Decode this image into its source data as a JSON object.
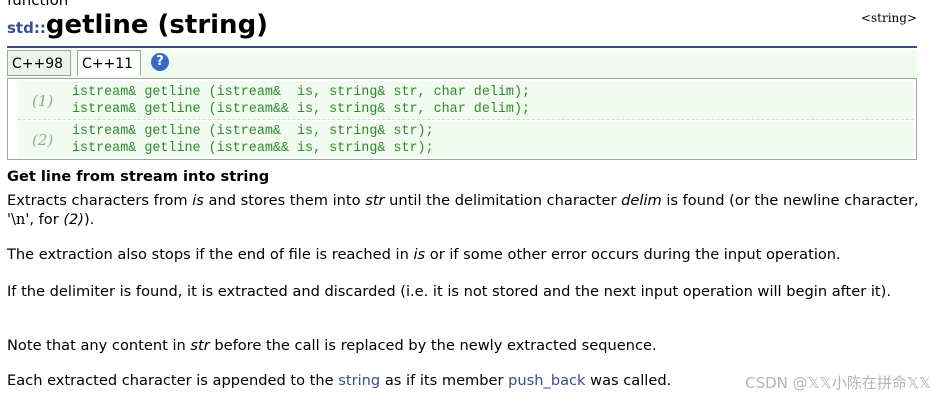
{
  "header": {
    "category": "function",
    "namespace": "std::",
    "function_name": "getline (string)",
    "header_tag": "<string>"
  },
  "tabs": {
    "cpp98": "C++98",
    "cpp11": "C++11",
    "help": "?"
  },
  "signatures": [
    {
      "number": "(1)",
      "lines": [
        "istream& getline (istream&  is, string& str, char delim);",
        "istream& getline (istream&& is, string& str, char delim);"
      ]
    },
    {
      "number": "(2)",
      "lines": [
        "istream& getline (istream&  is, string& str);",
        "istream& getline (istream&& is, string& str);"
      ]
    }
  ],
  "summary": "Get line from stream into string",
  "paragraphs": {
    "p1": {
      "t1": "Extracts characters from ",
      "i1": "is",
      "t2": " and stores them into ",
      "i2": "str",
      "t3": " until the delimitation character ",
      "i3": "delim",
      "t4": " is found (or the newline character, ",
      "code": "'\\n'",
      "t5": ", for ",
      "i4": "(2)",
      "t6": ")."
    },
    "p2": {
      "t1": "The extraction also stops if the end of file is reached in ",
      "i1": "is",
      "t2": " or if some other error occurs during the input operation."
    },
    "p3": "If the delimiter is found, it is extracted and discarded (i.e. it is not stored and the next input operation will begin after it).",
    "p4": {
      "t1": "Note that any content in ",
      "i1": "str",
      "t2": " before the call is replaced by the newly extracted sequence."
    },
    "p5": {
      "t1": "Each extracted character is appended to the ",
      "link1": "string",
      "t2": " as if its member ",
      "link2": "push_back",
      "t3": " was called."
    }
  },
  "watermark": "CSDN @𝕏𝕏小陈在拼命𝕏𝕏",
  "colors": {
    "namespace": "#3b4b8f",
    "code": "#2e8a2e",
    "link": "#3b4b8f",
    "sig_bg": "#f2fbf0"
  }
}
